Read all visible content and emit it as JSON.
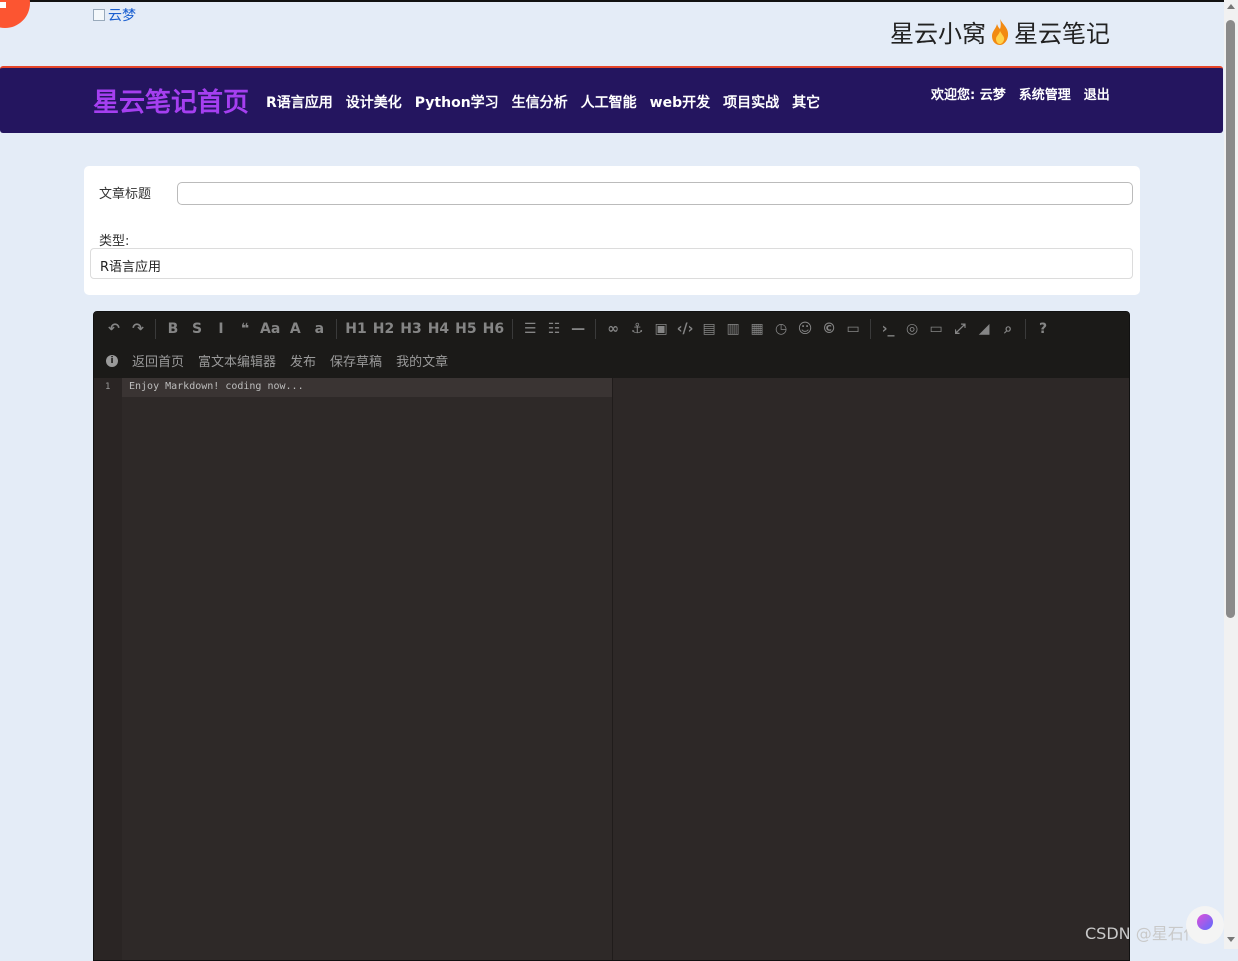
{
  "header": {
    "avatar_link": "云梦",
    "site_name_left": "星云小窝",
    "site_name_right": "星云笔记"
  },
  "nav": {
    "home": "星云笔记首页",
    "items": [
      "R语言应用",
      "设计美化",
      "Python学习",
      "生信分析",
      "人工智能",
      "web开发",
      "项目实战",
      "其它"
    ],
    "welcome": "欢迎您: 云梦",
    "admin": "系统管理",
    "logout": "退出"
  },
  "form": {
    "title_label": "文章标题",
    "title_value": "",
    "type_label": "类型:",
    "type_value": "R语言应用"
  },
  "editor": {
    "toolbar_row1": [
      {
        "name": "undo-icon",
        "glyph": "↶"
      },
      {
        "name": "redo-icon",
        "glyph": "↷"
      },
      {
        "sep": true
      },
      {
        "name": "bold-icon",
        "glyph": "B"
      },
      {
        "name": "strikethrough-icon",
        "glyph": "S"
      },
      {
        "name": "italic-icon",
        "glyph": "I"
      },
      {
        "name": "quote-icon",
        "glyph": "❝"
      },
      {
        "name": "ucwords-icon",
        "glyph": "Aa"
      },
      {
        "name": "uppercase-icon",
        "glyph": "A"
      },
      {
        "name": "lowercase-icon",
        "glyph": "a"
      },
      {
        "sep": true
      },
      {
        "name": "h1-icon",
        "glyph": "H1"
      },
      {
        "name": "h2-icon",
        "glyph": "H2"
      },
      {
        "name": "h3-icon",
        "glyph": "H3"
      },
      {
        "name": "h4-icon",
        "glyph": "H4"
      },
      {
        "name": "h5-icon",
        "glyph": "H5"
      },
      {
        "name": "h6-icon",
        "glyph": "H6"
      },
      {
        "sep": true
      },
      {
        "name": "unordered-list-icon",
        "glyph": "☰"
      },
      {
        "name": "ordered-list-icon",
        "glyph": "☷"
      },
      {
        "name": "horizontal-rule-icon",
        "glyph": "—"
      },
      {
        "sep": true
      },
      {
        "name": "link-icon",
        "glyph": "∞"
      },
      {
        "name": "anchor-icon",
        "glyph": "⚓"
      },
      {
        "name": "image-icon",
        "glyph": "▣"
      },
      {
        "name": "code-icon",
        "glyph": "‹/›"
      },
      {
        "name": "preformatted-code-icon",
        "glyph": "▤"
      },
      {
        "name": "code-block-icon",
        "glyph": "▥"
      },
      {
        "name": "table-icon",
        "glyph": "▦"
      },
      {
        "name": "datetime-icon",
        "glyph": "◷"
      },
      {
        "name": "emoji-icon",
        "glyph": "☺"
      },
      {
        "name": "html-entities-icon",
        "glyph": "©"
      },
      {
        "name": "pagebreak-icon",
        "glyph": "▭"
      },
      {
        "sep": true
      },
      {
        "name": "watch-icon",
        "glyph": "›_"
      },
      {
        "name": "unwatch-icon",
        "glyph": "◎"
      },
      {
        "name": "preview-icon",
        "glyph": "▭"
      },
      {
        "name": "fullscreen-icon",
        "glyph": "⤢"
      },
      {
        "name": "clear-icon",
        "glyph": "◢"
      },
      {
        "name": "search-icon",
        "glyph": "⌕"
      },
      {
        "sep": true
      },
      {
        "name": "help-icon",
        "glyph": "?"
      }
    ],
    "toolbar_row2": [
      "返回首页",
      "富文本编辑器",
      "发布",
      "保存草稿",
      "我的文章"
    ],
    "line_number": "1",
    "code_line": "Enjoy Markdown! coding now..."
  },
  "watermark": "CSDN @星石传说",
  "colors": {
    "page_bg": "#e4ecf7",
    "nav_bg": "#24155f",
    "nav_home": "#a53ff0",
    "accent_orange": "#fc5531",
    "editor_bg": "#2e2928",
    "toolbar_bg": "#1b1a18"
  }
}
